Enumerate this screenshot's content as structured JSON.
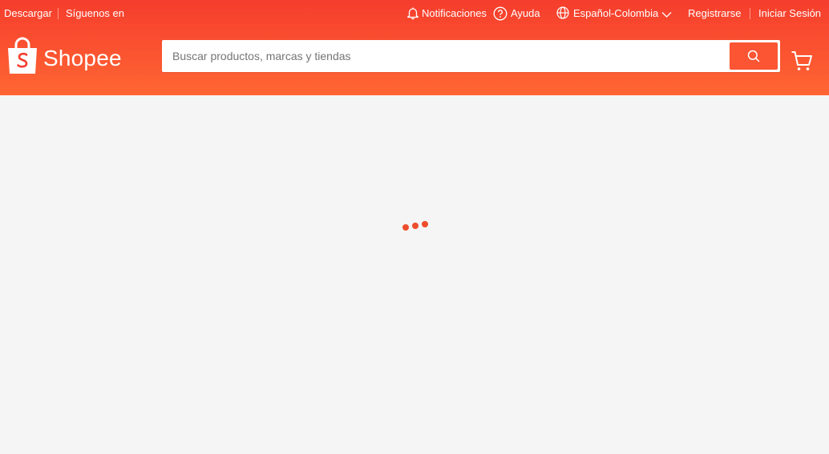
{
  "topbar": {
    "download": "Descargar",
    "follow_us": "Síguenos en",
    "notifications": "Notificaciones",
    "help": "Ayuda",
    "language": "Español-Colombia",
    "register": "Registrarse",
    "login": "Iniciar Sesión"
  },
  "logo": {
    "text": "Shopee"
  },
  "search": {
    "placeholder": "Buscar productos, marcas y tiendas",
    "value": ""
  },
  "icons": [
    "bell-icon",
    "help-circle-icon",
    "globe-icon",
    "chevron-down-icon",
    "search-icon",
    "cart-icon",
    "shopee-bag-icon"
  ],
  "colors": {
    "brand": "#ee4d2d",
    "header_top": "#f53d2d",
    "header_bottom": "#ff6633",
    "background": "#f5f5f5"
  },
  "loading": {
    "dots": 3
  }
}
